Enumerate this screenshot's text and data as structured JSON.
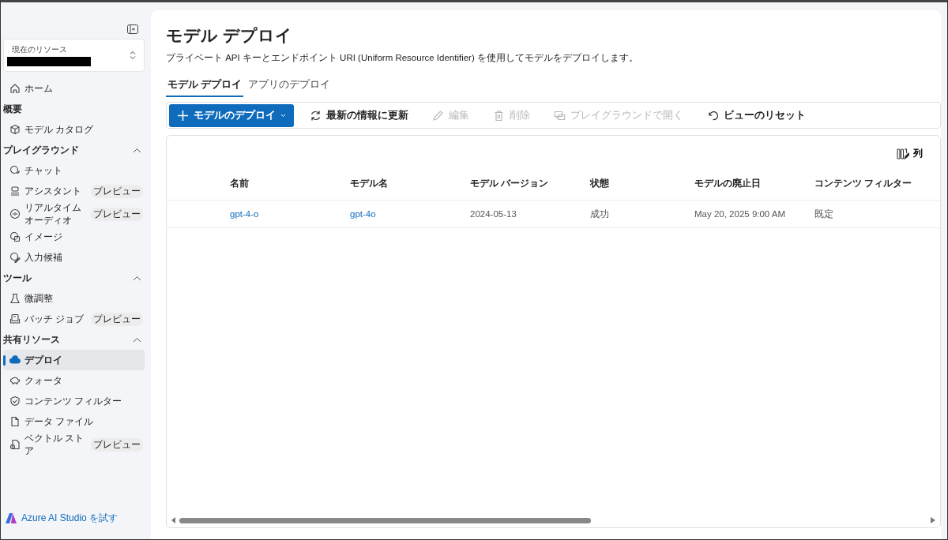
{
  "sidebar": {
    "resource": {
      "label": "現在のリソース"
    },
    "nav": [
      {
        "kind": "item",
        "label": "ホーム",
        "selected": false
      },
      {
        "kind": "heading",
        "label": "概要"
      },
      {
        "kind": "item",
        "label": "モデル カタログ",
        "selected": false
      },
      {
        "kind": "section",
        "label": "プレイグラウンド",
        "expanded": true
      },
      {
        "kind": "item",
        "label": "チャット",
        "selected": false
      },
      {
        "kind": "item",
        "label": "アシスタント",
        "badge": "プレビュー",
        "selected": false
      },
      {
        "kind": "item",
        "label": "リアルタイムオーディオ",
        "badge": "プレビュー",
        "selected": false
      },
      {
        "kind": "item",
        "label": "イメージ",
        "selected": false
      },
      {
        "kind": "item",
        "label": "入力候補",
        "selected": false
      },
      {
        "kind": "section",
        "label": "ツール",
        "expanded": true
      },
      {
        "kind": "item",
        "label": "微調整",
        "selected": false
      },
      {
        "kind": "item",
        "label": "バッチ ジョブ",
        "badge": "プレビュー",
        "selected": false
      },
      {
        "kind": "section",
        "label": "共有リソース",
        "expanded": true
      },
      {
        "kind": "item",
        "label": "デプロイ",
        "selected": true
      },
      {
        "kind": "item",
        "label": "クォータ",
        "selected": false
      },
      {
        "kind": "item",
        "label": "コンテンツ フィルター",
        "selected": false
      },
      {
        "kind": "item",
        "label": "データ ファイル",
        "selected": false
      },
      {
        "kind": "item",
        "label": "ベクトル ストア",
        "badge": "プレビュー",
        "selected": false
      }
    ],
    "footer_link": "Azure AI Studio を試す"
  },
  "page": {
    "title": "モデル デプロイ",
    "description": "プライベート API キーとエンドポイント URI (Uniform Resource Identifier) を使用してモデルをデプロイします。"
  },
  "tabs": [
    {
      "label": "モデル デプロイ",
      "selected": true
    },
    {
      "label": "アプリのデプロイ",
      "selected": false
    }
  ],
  "toolbar": [
    {
      "kind": "primary",
      "label": "モデルのデプロイ",
      "disabled": false
    },
    {
      "kind": "plain",
      "label": "最新の情報に更新",
      "disabled": false
    },
    {
      "kind": "plain",
      "label": "編集",
      "disabled": true
    },
    {
      "kind": "plain",
      "label": "削除",
      "disabled": true
    },
    {
      "kind": "plain",
      "label": "プレイグラウンドで開く",
      "disabled": true
    },
    {
      "kind": "plain",
      "label": "ビューのリセット",
      "disabled": false
    }
  ],
  "table": {
    "columns_button": "列",
    "columns": [
      "名前",
      "モデル名",
      "モデル バージョン",
      "状態",
      "モデルの廃止日",
      "コンテンツ フィルター"
    ],
    "rows": [
      {
        "cells": [
          {
            "kind": "link",
            "text": "gpt-4-o"
          },
          {
            "kind": "link",
            "text": "gpt-4o"
          },
          {
            "kind": "text",
            "text": "2024-05-13"
          },
          {
            "kind": "text",
            "text": "成功"
          },
          {
            "kind": "text",
            "text": "May 20, 2025 9:00 AM"
          },
          {
            "kind": "text",
            "text": "既定"
          }
        ]
      }
    ]
  }
}
